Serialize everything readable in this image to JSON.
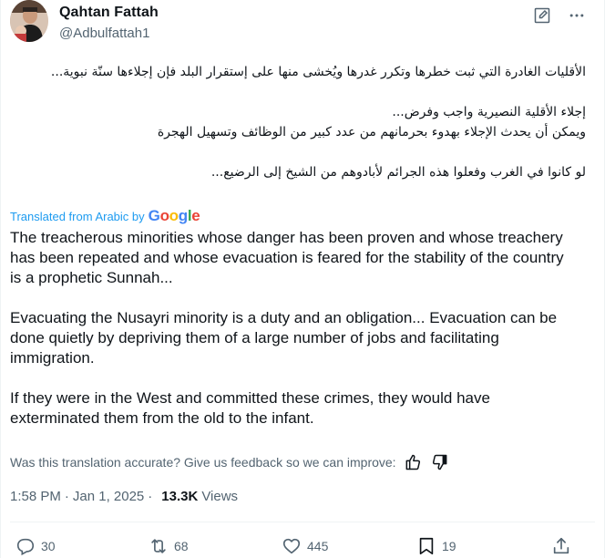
{
  "author": {
    "display_name": "Qahtan Fattah",
    "handle": "@Adbulfattah1"
  },
  "original_text": [
    "الأقليات الغادرة التي ثبت خطرها وتكرر غدرها ويُخشى منها على إستقرار البلد فإن إجلاءها سنّة نبوية...",
    "",
    "إجلاء الأقلية النصيرية واجب وفرض...",
    "ويمكن أن يحدث الإجلاء بهدوء بحرمانهم من عدد كبير من الوظائف وتسهيل الهجرة",
    "",
    "لو كانوا في الغرب وفعلوا هذه الجرائم  لأبادوهم من الشيخ إلى الرضيع..."
  ],
  "translation": {
    "label": "Translated from Arabic by",
    "provider": "Google",
    "paragraphs": [
      "The treacherous minorities whose danger has been proven and whose treachery has been repeated and whose evacuation is feared for the stability of the country is a prophetic Sunnah...",
      "Evacuating the Nusayri minority is a duty and an obligation... Evacuation can be done quietly by depriving them of a large number of jobs and facilitating immigration.",
      "If they were in the West and committed these crimes, they would have exterminated them from the old to the infant."
    ]
  },
  "feedback": {
    "prompt": "Was this translation accurate? Give us feedback so we can improve:"
  },
  "meta": {
    "time": "1:58 PM",
    "separator": "·",
    "date": "Jan 1, 2025",
    "views_count": "13.3K",
    "views_label": "Views"
  },
  "actions": {
    "replies": "30",
    "reposts": "68",
    "likes": "445",
    "bookmarks": "19"
  },
  "icons": {
    "edit": "edit-icon",
    "more": "more-icon",
    "reply": "reply-icon",
    "repost": "repost-icon",
    "like": "heart-icon",
    "bookmark": "bookmark-icon",
    "share": "share-icon",
    "thumbs_up": "thumbs-up-icon",
    "thumbs_down": "thumbs-down-icon"
  },
  "colors": {
    "accent": "#1d9bf0",
    "text_primary": "#0f1419",
    "text_secondary": "#536471"
  }
}
